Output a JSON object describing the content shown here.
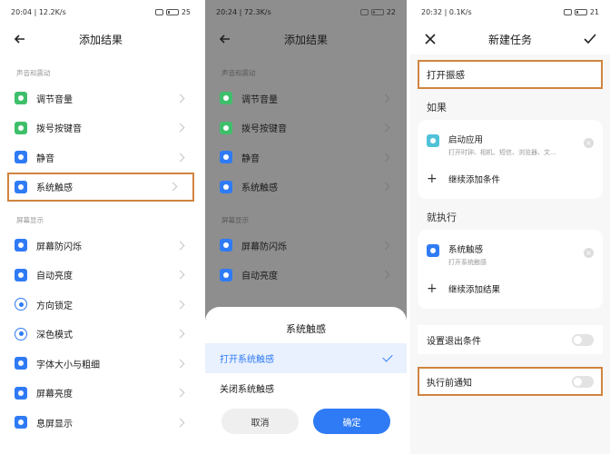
{
  "panel1": {
    "status": {
      "left": "20:04 | 12.2K/s",
      "right": "25"
    },
    "title": "添加结果",
    "section1": "声音和震动",
    "items1": [
      "调节音量",
      "拨号按键音",
      "静音",
      "系统触感"
    ],
    "section2": "屏幕显示",
    "items2": [
      "屏幕防闪烁",
      "自动亮度",
      "方向锁定",
      "深色模式",
      "字体大小与粗细",
      "屏幕亮度",
      "息屏显示"
    ]
  },
  "panel2": {
    "status": {
      "left": "20:24 | 72.3K/s",
      "right": "22"
    },
    "title": "添加结果",
    "section1": "声音和震动",
    "items1": [
      "调节音量",
      "拨号按键音",
      "静音",
      "系统触感"
    ],
    "section2": "屏幕显示",
    "items2": [
      "屏幕防闪烁",
      "自动亮度"
    ],
    "sheet": {
      "title": "系统触感",
      "option_on": "打开系统触感",
      "option_off": "关闭系统触感",
      "cancel": "取消",
      "confirm": "确定"
    }
  },
  "panel3": {
    "status": {
      "left": "20:32 | 0.1K/s",
      "right": "21"
    },
    "title": "新建任务",
    "task_name": "打开振感",
    "if_label": "如果",
    "if_item_title": "启动应用",
    "if_item_sub": "打开时钟、相机、短信、浏览器、文...",
    "add_condition": "继续添加条件",
    "then_label": "就执行",
    "then_item_title": "系统触感",
    "then_item_sub": "打开系统触感",
    "add_result": "继续添加结果",
    "exit_condition": "设置退出条件",
    "notify_before": "执行前通知"
  },
  "colors": {
    "accent": "#2f7bf5",
    "highlight": "#d0843f",
    "green": "#3fbf6b"
  }
}
